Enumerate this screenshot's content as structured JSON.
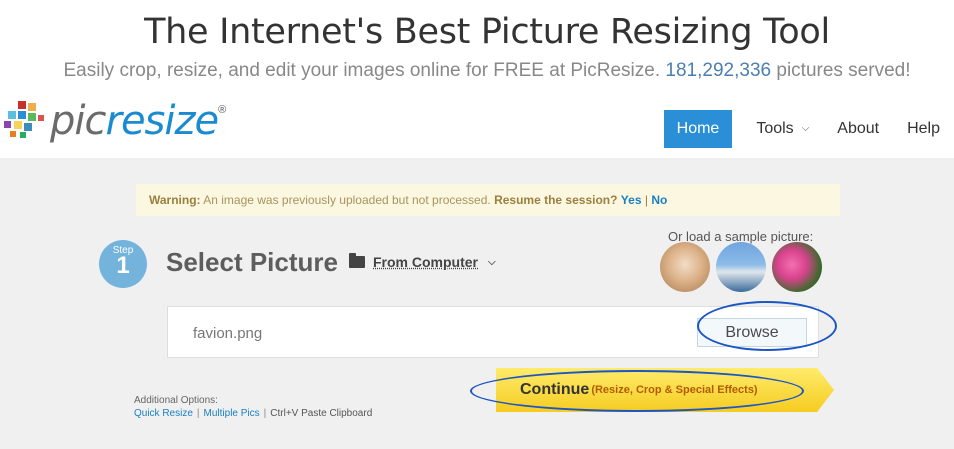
{
  "hero": {
    "title": "The Internet's Best Picture Resizing Tool",
    "subtitle_prefix": "Easily crop, resize, and edit your images online for FREE at PicResize.",
    "count": "181,292,336",
    "subtitle_suffix": "pictures served!"
  },
  "logo": {
    "pic": "pic",
    "resize": "resize",
    "reg": "®"
  },
  "nav": {
    "home": "Home",
    "tools": "Tools",
    "about": "About",
    "help": "Help"
  },
  "warning": {
    "label": "Warning:",
    "message": "An image was previously uploaded but not processed.",
    "question": "Resume the session?",
    "yes": "Yes",
    "separator": "|",
    "no": "No"
  },
  "step": {
    "word": "Step",
    "number": "1",
    "title": "Select Picture",
    "source": "From Computer"
  },
  "samples": {
    "label": "Or load a sample picture:"
  },
  "file": {
    "name": "favion.png",
    "browse": "Browse"
  },
  "continue": {
    "main": "Continue",
    "sub": "(Resize, Crop & Special Effects)"
  },
  "options": {
    "label": "Additional Options:",
    "quick_resize": "Quick Resize",
    "multiple_pics": "Multiple Pics",
    "paste": "Ctrl+V Paste Clipboard",
    "separator": "|"
  },
  "colors": {
    "accent": "#2a8fd6",
    "brand_blue": "#1a8bd0",
    "annotation_ring": "#1c55c4",
    "continue_yellow": "#f5cc21"
  }
}
